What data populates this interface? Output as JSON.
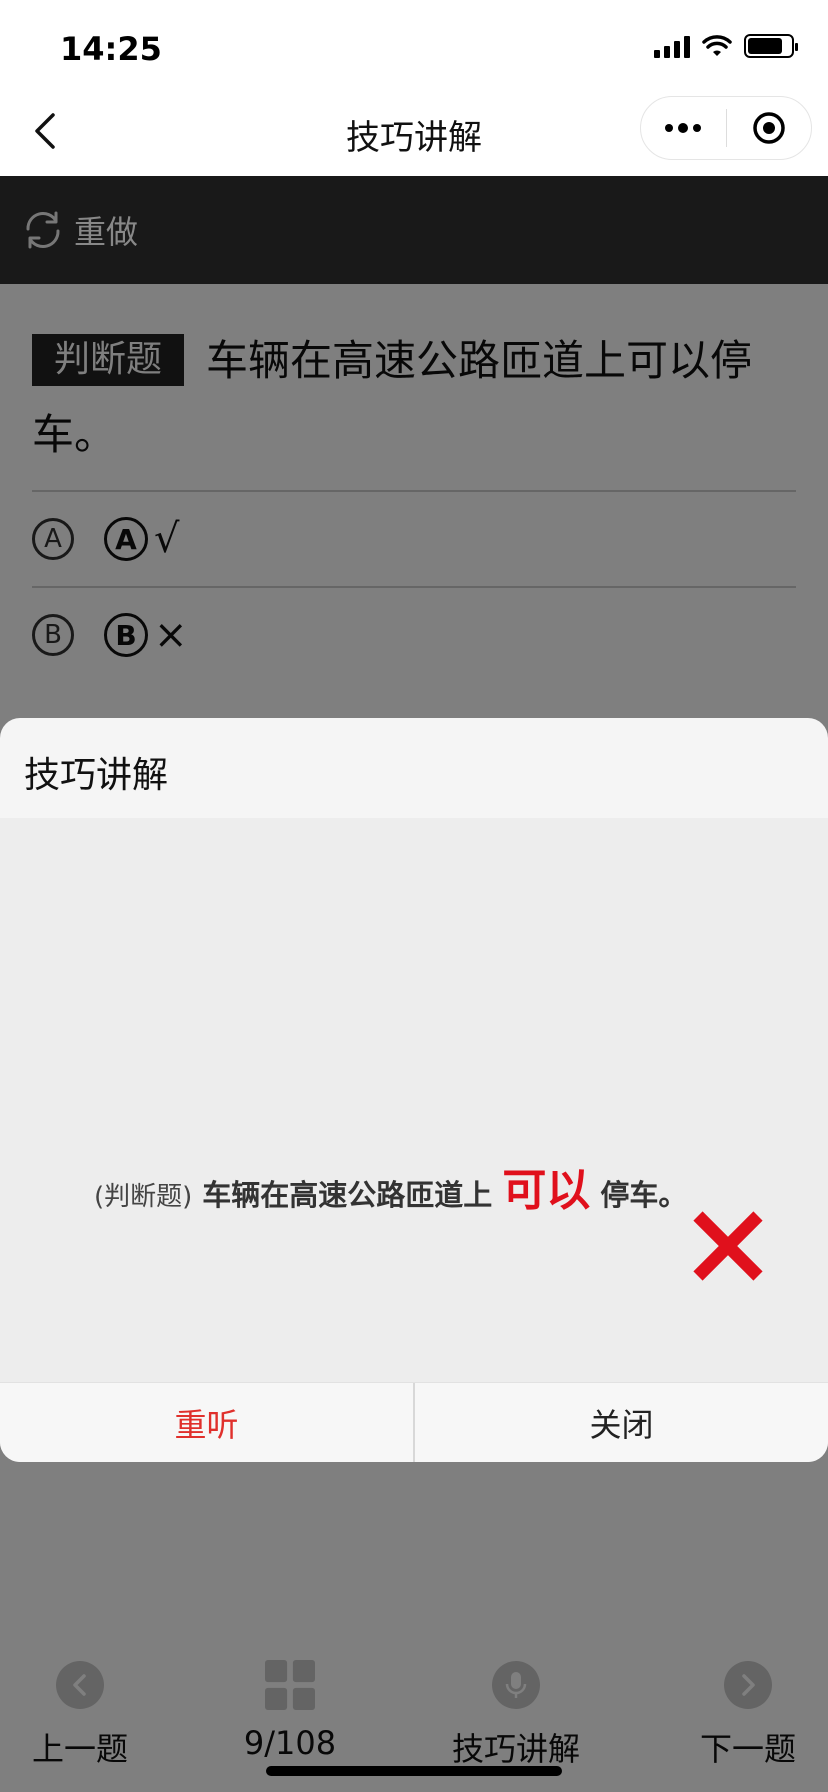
{
  "status_bar": {
    "time": "14:25"
  },
  "nav": {
    "title": "技巧讲解"
  },
  "toolbar": {
    "redo_label": "重做"
  },
  "question": {
    "type_tag": "判断题",
    "text": "车辆在高速公路匝道上可以停车。",
    "options": [
      {
        "marker": "A",
        "letter": "A",
        "value": "√"
      },
      {
        "marker": "B",
        "letter": "B",
        "value": "×"
      }
    ]
  },
  "dialog": {
    "title": "技巧讲解",
    "media": {
      "tag": "(判断题)",
      "text_main": "车辆在高速公路匝道上",
      "text_highlight": "可以",
      "text_end": "停车。",
      "verdict_icon": "red-cross-icon",
      "highlight_color": "#e0101c"
    },
    "replay_label": "重听",
    "close_label": "关闭"
  },
  "bottom_bar": {
    "prev_label": "上一题",
    "progress_label": "9/108",
    "tips_label": "技巧讲解",
    "next_label": "下一题"
  }
}
